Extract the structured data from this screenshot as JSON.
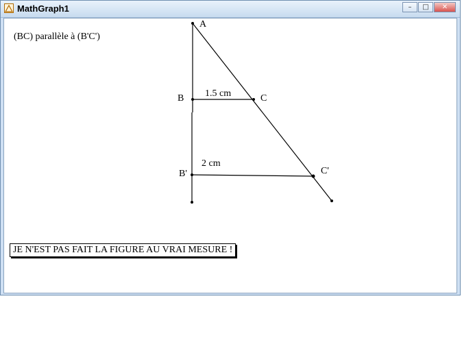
{
  "window": {
    "title": "MathGraph1",
    "buttons": {
      "minimize": "–",
      "maximize": "□",
      "close": "✕"
    }
  },
  "figure": {
    "note": "(BC) parallèle à (B'C')",
    "points": {
      "A": "A",
      "B": "B",
      "C": "C",
      "B_prime": "B'",
      "C_prime": "C'"
    },
    "measures": {
      "bc": "1.5 cm",
      "bpcp": "2 cm"
    },
    "message": "JE N'EST PAS FAIT LA FIGURE AU VRAI MESURE !"
  },
  "colors": {
    "client_bg": "#ffffff",
    "frame": "#cfe0f3",
    "ink": "#000000",
    "close_button": "#d9534f"
  }
}
